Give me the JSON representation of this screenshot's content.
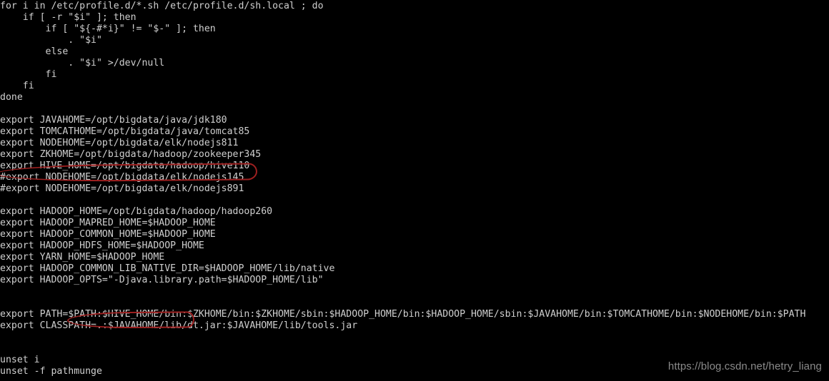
{
  "terminal": {
    "background_color": "#000000",
    "text_color": "#cfcfcf",
    "annotation_color": "#9e2020",
    "lines": [
      "for i in /etc/profile.d/*.sh /etc/profile.d/sh.local ; do",
      "    if [ -r \"$i\" ]; then",
      "        if [ \"${-#*i}\" != \"$-\" ]; then",
      "            . \"$i\"",
      "        else",
      "            . \"$i\" >/dev/null",
      "        fi",
      "    fi",
      "done",
      "",
      "export JAVAHOME=/opt/bigdata/java/jdk180",
      "export TOMCATHOME=/opt/bigdata/java/tomcat85",
      "export NODEHOME=/opt/bigdata/elk/nodejs811",
      "export ZKHOME=/opt/bigdata/hadoop/zookeeper345",
      "export HIVE_HOME=/opt/bigdata/hadoop/hive110",
      "#export NODEHOME=/opt/bigdata/elk/nodejs145",
      "#export NODEHOME=/opt/bigdata/elk/nodejs891",
      "",
      "export HADOOP_HOME=/opt/bigdata/hadoop/hadoop260",
      "export HADOOP_MAPRED_HOME=$HADOOP_HOME",
      "export HADOOP_COMMON_HOME=$HADOOP_HOME",
      "export HADOOP_HDFS_HOME=$HADOOP_HOME",
      "export YARN_HOME=$HADOOP_HOME",
      "export HADOOP_COMMON_LIB_NATIVE_DIR=$HADOOP_HOME/lib/native",
      "export HADOOP_OPTS=\"-Djava.library.path=$HADOOP_HOME/lib\"",
      "",
      "",
      "export PATH=$PATH:$HIVE_HOME/bin:$ZKHOME/bin:$ZKHOME/sbin:$HADOOP_HOME/bin:$HADOOP_HOME/sbin:$JAVAHOME/bin:$TOMCATHOME/bin:$NODEHOME/bin:$PATH",
      "export CLASSPATH=.:$JAVAHOME/lib/dt.jar:$JAVAHOME/lib/tools.jar",
      "",
      "",
      "unset i",
      "unset -f pathmunge"
    ]
  },
  "annotations": [
    {
      "name": "hive-home-highlight",
      "target_text": "export HIVE_HOME=/opt/bigdata/hadoop/hive110"
    },
    {
      "name": "path-hive-bin-highlight",
      "target_text": "$PATH:$HIVE_HOME/bin:"
    }
  ],
  "watermark": {
    "text": "https://blog.csdn.net/hetry_liang"
  }
}
